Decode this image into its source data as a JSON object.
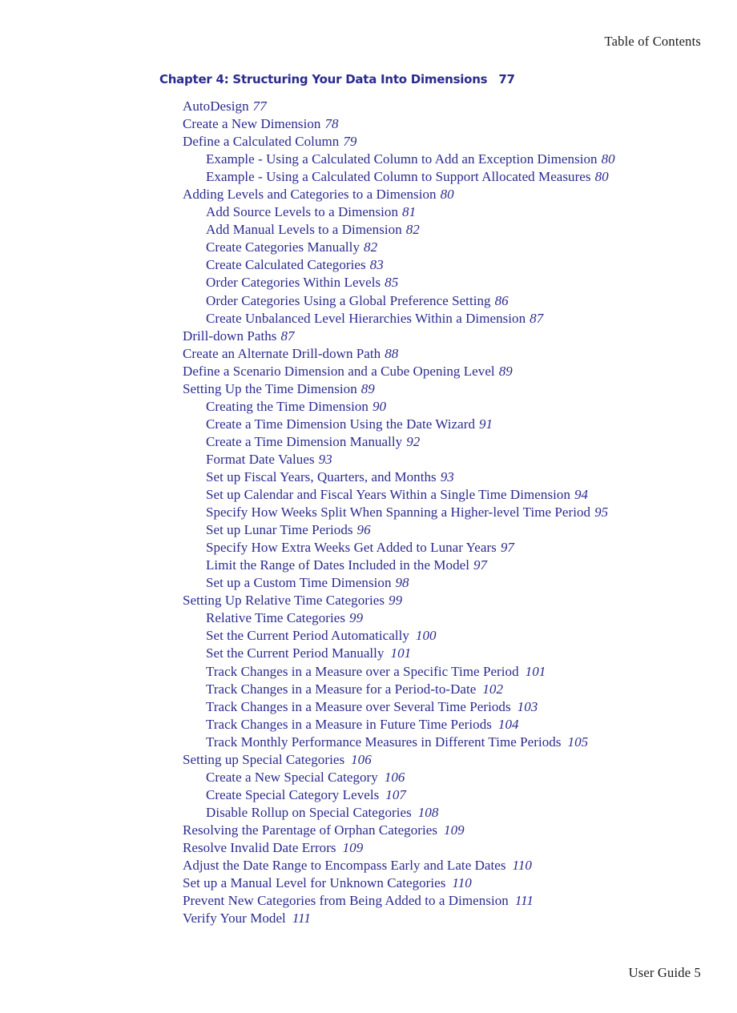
{
  "running_head": "Table of Contents",
  "running_foot": "User Guide 5",
  "colors": {
    "entry_text": "#2b2b8f",
    "head_foot_text": "#1c1c1c",
    "page_background": "#ffffff"
  },
  "chapter": {
    "title": "Chapter  4:  Structuring Your Data Into Dimensions",
    "page": "77"
  },
  "entries": [
    {
      "level": 1,
      "title": "AutoDesign",
      "page": "77"
    },
    {
      "level": 1,
      "title": "Create a New Dimension",
      "page": "78"
    },
    {
      "level": 1,
      "title": "Define a Calculated Column",
      "page": "79"
    },
    {
      "level": 2,
      "title": "Example - Using a Calculated Column to Add an Exception Dimension",
      "page": "80"
    },
    {
      "level": 2,
      "title": "Example - Using a Calculated Column to Support Allocated Measures",
      "page": "80"
    },
    {
      "level": 1,
      "title": "Adding Levels and Categories to a Dimension",
      "page": "80"
    },
    {
      "level": 2,
      "title": "Add Source Levels to a Dimension",
      "page": "81"
    },
    {
      "level": 2,
      "title": "Add Manual Levels to a Dimension",
      "page": "82"
    },
    {
      "level": 2,
      "title": "Create Categories Manually",
      "page": "82"
    },
    {
      "level": 2,
      "title": "Create Calculated Categories",
      "page": "83"
    },
    {
      "level": 2,
      "title": "Order Categories Within Levels",
      "page": "85"
    },
    {
      "level": 2,
      "title": "Order Categories Using a Global Preference Setting",
      "page": "86"
    },
    {
      "level": 2,
      "title": "Create Unbalanced Level Hierarchies Within a Dimension",
      "page": "87"
    },
    {
      "level": 1,
      "title": "Drill-down Paths",
      "page": "87"
    },
    {
      "level": 1,
      "title": "Create an Alternate Drill-down Path",
      "page": "88"
    },
    {
      "level": 1,
      "title": "Define a Scenario Dimension and a Cube Opening Level",
      "page": "89"
    },
    {
      "level": 1,
      "title": "Setting Up the Time Dimension",
      "page": "89"
    },
    {
      "level": 2,
      "title": "Creating the Time Dimension",
      "page": "90"
    },
    {
      "level": 2,
      "title": "Create a Time Dimension Using the Date Wizard",
      "page": "91"
    },
    {
      "level": 2,
      "title": "Create a Time Dimension Manually",
      "page": "92"
    },
    {
      "level": 2,
      "title": "Format Date Values",
      "page": "93"
    },
    {
      "level": 2,
      "title": "Set up Fiscal Years, Quarters, and Months",
      "page": "93"
    },
    {
      "level": 2,
      "title": "Set up Calendar and Fiscal Years Within a Single Time Dimension",
      "page": "94"
    },
    {
      "level": 2,
      "title": "Specify How Weeks Split When Spanning a Higher-level Time Period",
      "page": "95"
    },
    {
      "level": 2,
      "title": "Set up Lunar Time Periods",
      "page": "96"
    },
    {
      "level": 2,
      "title": "Specify How Extra Weeks Get Added to Lunar Years",
      "page": "97"
    },
    {
      "level": 2,
      "title": "Limit the Range of Dates Included in the Model",
      "page": "97"
    },
    {
      "level": 2,
      "title": "Set up a Custom Time Dimension",
      "page": "98"
    },
    {
      "level": 1,
      "title": "Setting Up Relative Time Categories",
      "page": "99"
    },
    {
      "level": 2,
      "title": "Relative Time Categories",
      "page": "99"
    },
    {
      "level": 2,
      "title": "Set the Current Period Automatically",
      "page": "100"
    },
    {
      "level": 2,
      "title": "Set the Current Period Manually",
      "page": "101"
    },
    {
      "level": 2,
      "title": "Track Changes in a Measure over a Specific Time Period",
      "page": "101"
    },
    {
      "level": 2,
      "title": "Track Changes in a Measure for a Period-to-Date",
      "page": "102"
    },
    {
      "level": 2,
      "title": "Track Changes in a Measure over Several Time Periods",
      "page": "103"
    },
    {
      "level": 2,
      "title": "Track Changes in a Measure in Future Time Periods",
      "page": "104"
    },
    {
      "level": 2,
      "title": "Track Monthly Performance Measures in Different Time Periods",
      "page": "105"
    },
    {
      "level": 1,
      "title": "Setting up Special Categories",
      "page": "106"
    },
    {
      "level": 2,
      "title": "Create a New Special Category",
      "page": "106"
    },
    {
      "level": 2,
      "title": "Create Special Category Levels",
      "page": "107"
    },
    {
      "level": 2,
      "title": "Disable Rollup on Special Categories",
      "page": "108"
    },
    {
      "level": 1,
      "title": "Resolving the Parentage of Orphan Categories",
      "page": "109"
    },
    {
      "level": 1,
      "title": "Resolve Invalid Date Errors",
      "page": "109"
    },
    {
      "level": 1,
      "title": "Adjust the Date Range to Encompass Early and Late Dates",
      "page": "110"
    },
    {
      "level": 1,
      "title": "Set up a Manual Level for Unknown Categories",
      "page": "110"
    },
    {
      "level": 1,
      "title": "Prevent New Categories from Being Added to a Dimension",
      "page": "111"
    },
    {
      "level": 1,
      "title": "Verify Your Model",
      "page": "111"
    }
  ]
}
